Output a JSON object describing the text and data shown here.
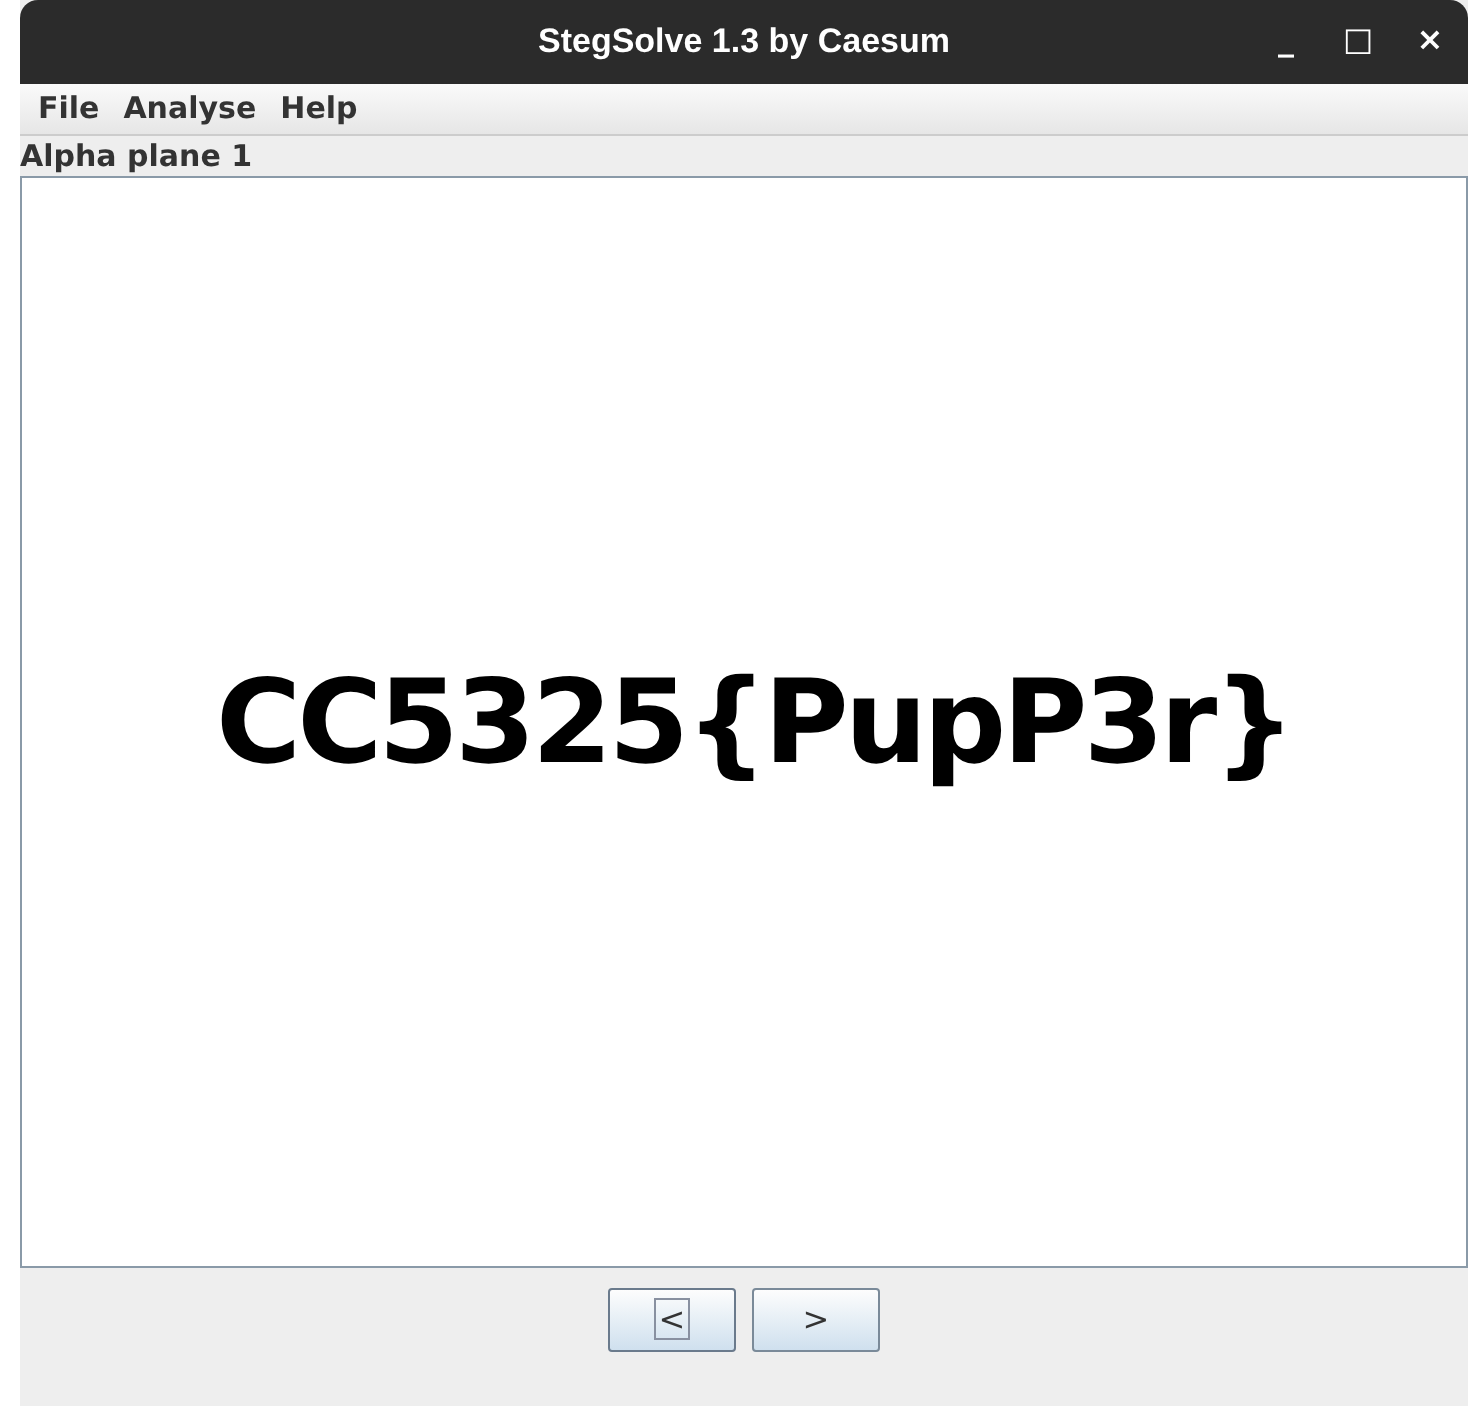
{
  "window": {
    "title": "StegSolve 1.3 by Caesum",
    "controls": [
      "_",
      "□",
      "×"
    ]
  },
  "menu": [
    "File",
    "Analyse",
    "Help"
  ],
  "plane_label": "Alpha plane 1",
  "image_text": "CC5325{PupP3r}",
  "buttons": [
    {
      "label": "<",
      "focused": true
    },
    {
      "label": ">",
      "focused": false
    }
  ]
}
